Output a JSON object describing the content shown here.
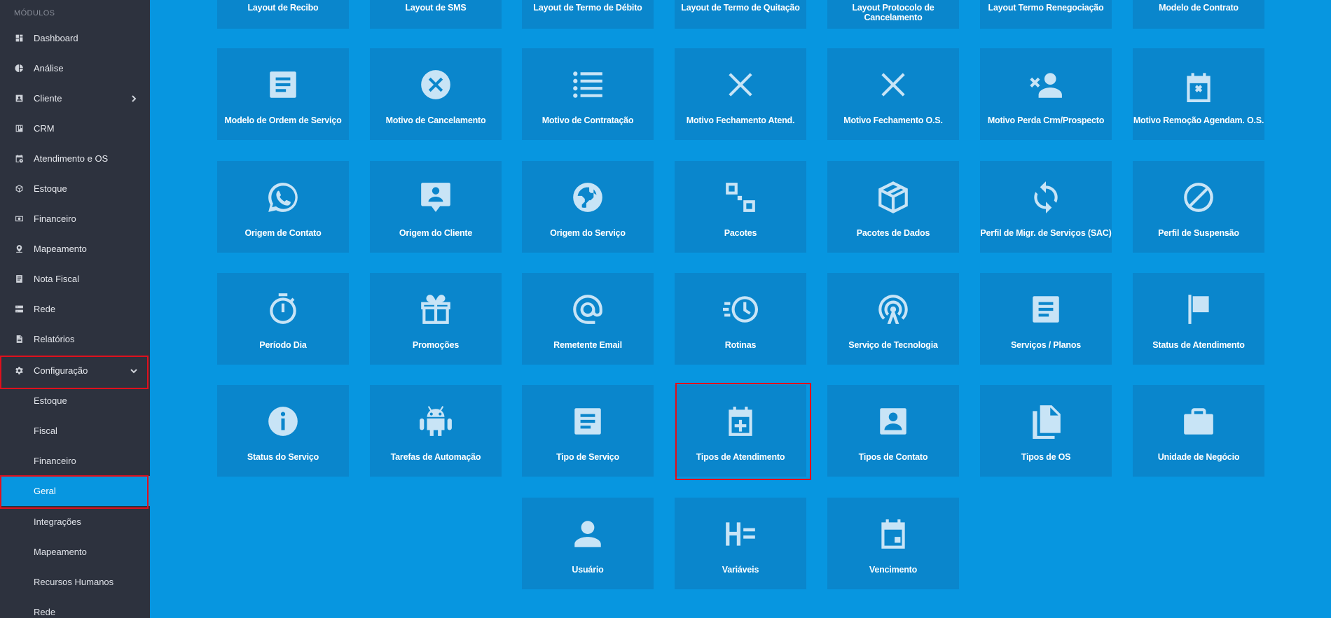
{
  "sidebar": {
    "header": "MÓDULOS",
    "items": [
      {
        "label": "Dashboard",
        "icon": "dashboard-icon"
      },
      {
        "label": "Análise",
        "icon": "pie-chart-icon"
      },
      {
        "label": "Cliente",
        "icon": "contact-card-icon"
      },
      {
        "label": "CRM",
        "icon": "kanban-icon"
      },
      {
        "label": "Atendimento e OS",
        "icon": "calendar-clock-icon"
      },
      {
        "label": "Estoque",
        "icon": "box-icon"
      },
      {
        "label": "Financeiro",
        "icon": "money-icon"
      },
      {
        "label": "Mapeamento",
        "icon": "map-pin-icon"
      },
      {
        "label": "Nota Fiscal",
        "icon": "receipt-icon"
      },
      {
        "label": "Rede",
        "icon": "server-icon"
      },
      {
        "label": "Relatórios",
        "icon": "file-icon"
      },
      {
        "label": "Configuração",
        "icon": "gear-icon"
      }
    ],
    "subitems": [
      {
        "label": "Estoque"
      },
      {
        "label": "Fiscal"
      },
      {
        "label": "Financeiro"
      },
      {
        "label": "Geral"
      },
      {
        "label": "Integrações"
      },
      {
        "label": "Mapeamento"
      },
      {
        "label": "Recursos Humanos"
      },
      {
        "label": "Rede"
      }
    ]
  },
  "grid": {
    "top_row": [
      {
        "label": "Layout de Recibo"
      },
      {
        "label": "Layout de SMS"
      },
      {
        "label": "Layout de Termo de Débito"
      },
      {
        "label": "Layout de Termo de Quitação"
      },
      {
        "label": "Layout Protocolo de Cancelamento"
      },
      {
        "label": "Layout Termo Renegociação"
      },
      {
        "label": "Modelo de Contrato"
      }
    ],
    "tiles": [
      {
        "label": "Modelo de Ordem de Serviço",
        "icon": "document-lines-icon"
      },
      {
        "label": "Motivo de Cancelamento",
        "icon": "circle-x-icon"
      },
      {
        "label": "Motivo de Contratação",
        "icon": "list-icon"
      },
      {
        "label": "Motivo Fechamento Atend.",
        "icon": "close-icon"
      },
      {
        "label": "Motivo Fechamento O.S.",
        "icon": "close-icon"
      },
      {
        "label": "Motivo Perda Crm/Prospecto",
        "icon": "user-remove-icon"
      },
      {
        "label": "Motivo Remoção Agendam. O.S.",
        "icon": "calendar-x-icon"
      },
      {
        "label": "Origem de Contato",
        "icon": "whatsapp-icon"
      },
      {
        "label": "Origem do Cliente",
        "icon": "chat-person-icon"
      },
      {
        "label": "Origem do Serviço",
        "icon": "globe-icon"
      },
      {
        "label": "Pacotes",
        "icon": "squares-icon"
      },
      {
        "label": "Pacotes de Dados",
        "icon": "package-icon"
      },
      {
        "label": "Perfil de Migr. de Serviços (SAC)",
        "icon": "sync-icon"
      },
      {
        "label": "Perfil de Suspensão",
        "icon": "block-icon"
      },
      {
        "label": "Período Dia",
        "icon": "stopwatch-icon"
      },
      {
        "label": "Promoções",
        "icon": "gift-icon"
      },
      {
        "label": "Remetente Email",
        "icon": "at-icon"
      },
      {
        "label": "Rotinas",
        "icon": "fast-clock-icon"
      },
      {
        "label": "Serviço de Tecnologia",
        "icon": "antenna-icon"
      },
      {
        "label": "Serviços / Planos",
        "icon": "document-lines-icon"
      },
      {
        "label": "Status de Atendimento",
        "icon": "flag-icon"
      },
      {
        "label": "Status do Serviço",
        "icon": "info-icon"
      },
      {
        "label": "Tarefas de Automação",
        "icon": "android-icon"
      },
      {
        "label": "Tipo de Serviço",
        "icon": "document-lines-icon"
      },
      {
        "label": "Tipos de Atendimento",
        "icon": "calendar-plus-icon"
      },
      {
        "label": "Tipos de Contato",
        "icon": "contact-box-icon"
      },
      {
        "label": "Tipos de OS",
        "icon": "files-icon"
      },
      {
        "label": "Unidade de Negócio",
        "icon": "briefcase-icon"
      },
      {
        "label": "Usuário",
        "icon": "user-icon"
      },
      {
        "label": "Variáveis",
        "icon": "variables-icon"
      },
      {
        "label": "Vencimento",
        "icon": "calendar-day-icon"
      }
    ]
  }
}
